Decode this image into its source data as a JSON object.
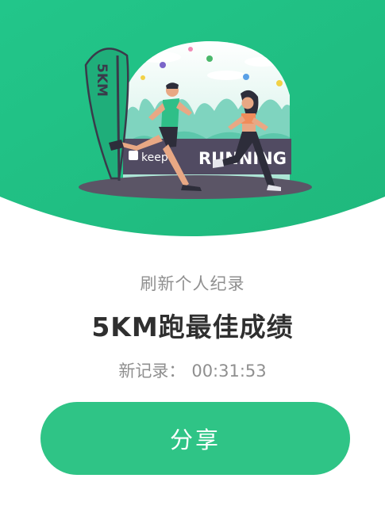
{
  "illustration": {
    "flag_text": "5KM",
    "banner_brand": "keep",
    "banner_text": "RUNNING"
  },
  "achievement": {
    "subtitle": "刷新个人纪录",
    "title": "5KM跑最佳成绩",
    "record_label": "新记录：",
    "record_value": "00:31:53"
  },
  "actions": {
    "share_label": "分享"
  },
  "colors": {
    "brand_green": "#2fc486",
    "title_text": "#2f2f2f",
    "secondary_text": "#8f8f8f"
  }
}
